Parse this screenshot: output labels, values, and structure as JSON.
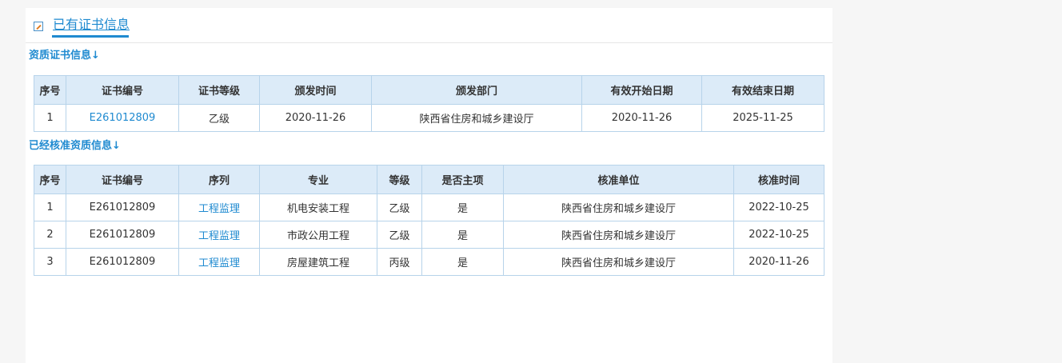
{
  "header": {
    "title": "已有证书信息",
    "icon": "edit-icon"
  },
  "qualification": {
    "title": "资质证书信息↓",
    "columns": [
      "序号",
      "证书编号",
      "证书等级",
      "颁发时间",
      "颁发部门",
      "有效开始日期",
      "有效结束日期"
    ],
    "rows": [
      [
        "1",
        "E261012809",
        "乙级",
        "2020-11-26",
        "陕西省住房和城乡建设厅",
        "2020-11-26",
        "2025-11-25"
      ]
    ]
  },
  "approved": {
    "title": "已经核准资质信息↓",
    "columns": [
      "序号",
      "证书编号",
      "序列",
      "专业",
      "等级",
      "是否主项",
      "核准单位",
      "核准时间"
    ],
    "rows": [
      [
        "1",
        "E261012809",
        "工程监理",
        "机电安装工程",
        "乙级",
        "是",
        "陕西省住房和城乡建设厅",
        "2022-10-25"
      ],
      [
        "2",
        "E261012809",
        "工程监理",
        "市政公用工程",
        "乙级",
        "是",
        "陕西省住房和城乡建设厅",
        "2022-10-25"
      ],
      [
        "3",
        "E261012809",
        "工程监理",
        "房屋建筑工程",
        "丙级",
        "是",
        "陕西省住房和城乡建设厅",
        "2020-11-26"
      ]
    ]
  }
}
